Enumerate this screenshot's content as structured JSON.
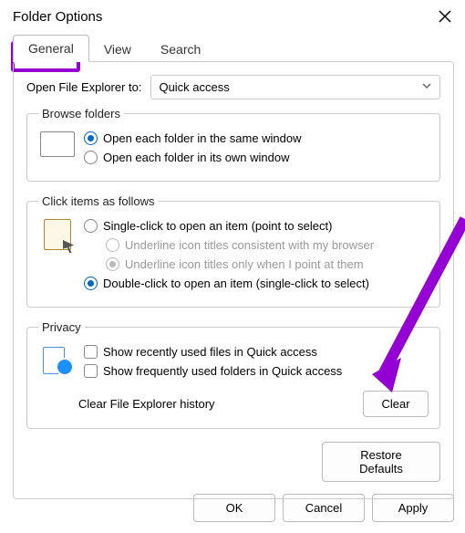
{
  "title": "Folder Options",
  "tabs": {
    "general": "General",
    "view": "View",
    "search": "Search"
  },
  "open_explorer": {
    "label": "Open File Explorer to:",
    "value": "Quick access"
  },
  "browse": {
    "legend": "Browse folders",
    "same": "Open each folder in the same window",
    "own": "Open each folder in its own window"
  },
  "click": {
    "legend": "Click items as follows",
    "single": "Single-click to open an item (point to select)",
    "underline_browser": "Underline icon titles consistent with my browser",
    "underline_point": "Underline icon titles only when I point at them",
    "double": "Double-click to open an item (single-click to select)"
  },
  "privacy": {
    "legend": "Privacy",
    "recent": "Show recently used files in Quick access",
    "frequent": "Show frequently used folders in Quick access",
    "clear_label": "Clear File Explorer history",
    "clear_btn": "Clear"
  },
  "restore": "Restore Defaults",
  "footer": {
    "ok": "OK",
    "cancel": "Cancel",
    "apply": "Apply"
  }
}
